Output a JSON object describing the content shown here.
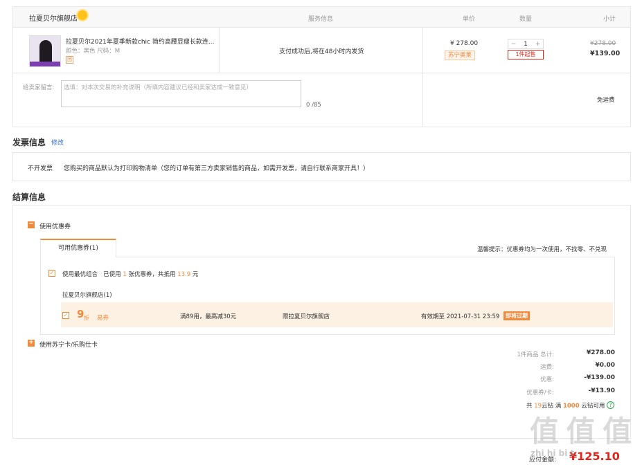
{
  "order": {
    "shop_name": "拉夏贝尔旗舰店",
    "headers": {
      "service": "服务信息",
      "unit_price": "单价",
      "quantity": "数量",
      "subtotal": "小计"
    },
    "product": {
      "title": "拉夏贝尔2021年夏季新款chic 简约高腰显瘦长款连...",
      "attributes": "颜色：黑色   尺码：M",
      "tuan_badge": "团",
      "service_text": "支付成功后,将在48小时内发货",
      "price": "¥ 278.00",
      "selection_badge": "苏宁SELECTION严选",
      "selection_badge_display": "苏宁奥莱",
      "qty_minus": "−",
      "qty_value": "1",
      "qty_plus": "+",
      "qty_tip": "1件起售",
      "old_price": "¥278.00",
      "new_price": "¥139.00"
    },
    "message": {
      "label": "给卖家留言:",
      "placeholder": "选填：对本次交易的补充说明（所填内容建议已经和卖家达成一致意见）",
      "count": "0 /85"
    },
    "shipping": "免运费"
  },
  "invoice": {
    "title": "发票信息",
    "modify": "修改",
    "type": "不开发票",
    "desc": "您购买的商品默认为打印购物清单（您的订单有第三方卖家销售的商品，如需开发票，请自行联系商家开具！）"
  },
  "settlement": {
    "title": "结算信息",
    "use_coupon": "使用优惠券",
    "tab_available": "可用优惠券(1)",
    "tip": "温馨提示：优惠券均为一次使用，不找零、不兑现",
    "best_combo": "使用最优组合",
    "used_prefix": "已使用",
    "used_count": "1",
    "used_mid": "张优惠券，共抵用",
    "used_amount": "13.9",
    "used_suffix": "元",
    "shop_coupons": "拉夏贝尔旗舰店(1)",
    "coupon": {
      "discount": "9",
      "discount_unit": "折",
      "type": "易券",
      "condition": "满89用，最高减30元",
      "limit": "限拉夏贝尔旗舰店",
      "validity": "有效期至 2021-07-31 23:59",
      "expire_badge": "即将过期"
    },
    "use_card": "使用苏宁卡/乐购仕卡",
    "summary": [
      {
        "label": "1件商品 总计:",
        "value": "¥278.00"
      },
      {
        "label": "运费:",
        "value": "¥0.00"
      },
      {
        "label": "优惠:",
        "value": "-¥139.00"
      },
      {
        "label": "优惠券/卡:",
        "value": "-¥13.90"
      }
    ],
    "yunzuan_prefix": "共",
    "yunzuan_count": "19",
    "yunzuan_mid": "云钻 满",
    "yunzuan_min": "1000",
    "yunzuan_suffix": "云钻可用",
    "pay_label": "应付金额:",
    "pay_total": "¥125.10"
  },
  "watermark": {
    "logo": "值 值 值",
    "site": "zhi hi bi t"
  }
}
